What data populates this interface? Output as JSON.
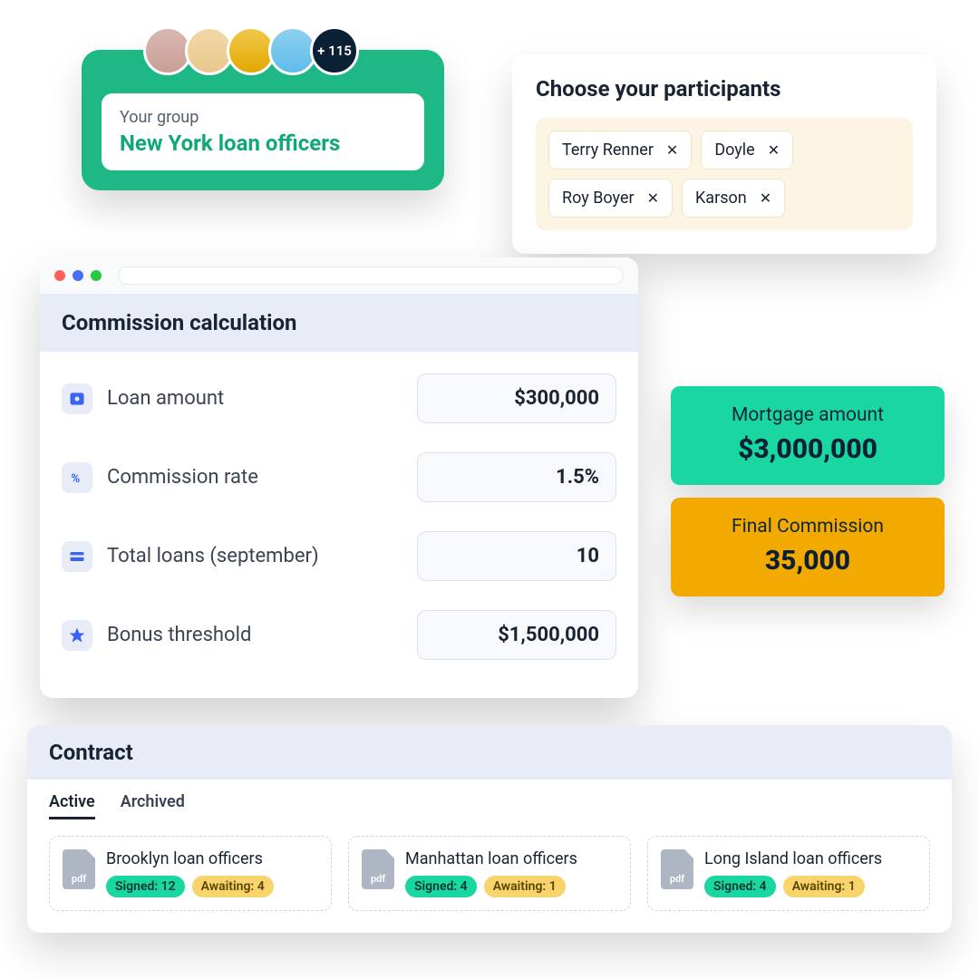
{
  "group": {
    "overflow": "+ 115",
    "your_group_label": "Your group",
    "name": "New York loan officers"
  },
  "participants": {
    "title": "Choose your participants",
    "chips": [
      "Terry Renner",
      "Doyle",
      "Roy Boyer",
      "Karson"
    ]
  },
  "calc": {
    "title": "Commission calculation",
    "rows": [
      {
        "label": "Loan amount",
        "value": "$300,000"
      },
      {
        "label": "Commission rate",
        "value": "1.5%"
      },
      {
        "label": "Total loans (september)",
        "value": "10"
      },
      {
        "label": "Bonus threshold",
        "value": "$1,500,000"
      }
    ]
  },
  "results": {
    "mortgage_label": "Mortgage amount",
    "mortgage_value": "$3,000,000",
    "commission_label": "Final Commission",
    "commission_value": "35,000"
  },
  "contract": {
    "title": "Contract",
    "tabs": {
      "active": "Active",
      "archived": "Archived"
    },
    "pdf_label": "pdf",
    "tiles": [
      {
        "name": "Brooklyn loan officers",
        "signed": "Signed: 12",
        "awaiting": "Awaiting: 4"
      },
      {
        "name": "Manhattan loan officers",
        "signed": "Signed: 4",
        "awaiting": "Awaiting: 1"
      },
      {
        "name": "Long Island loan officers",
        "signed": "Signed: 4",
        "awaiting": "Awaiting: 1"
      }
    ]
  }
}
